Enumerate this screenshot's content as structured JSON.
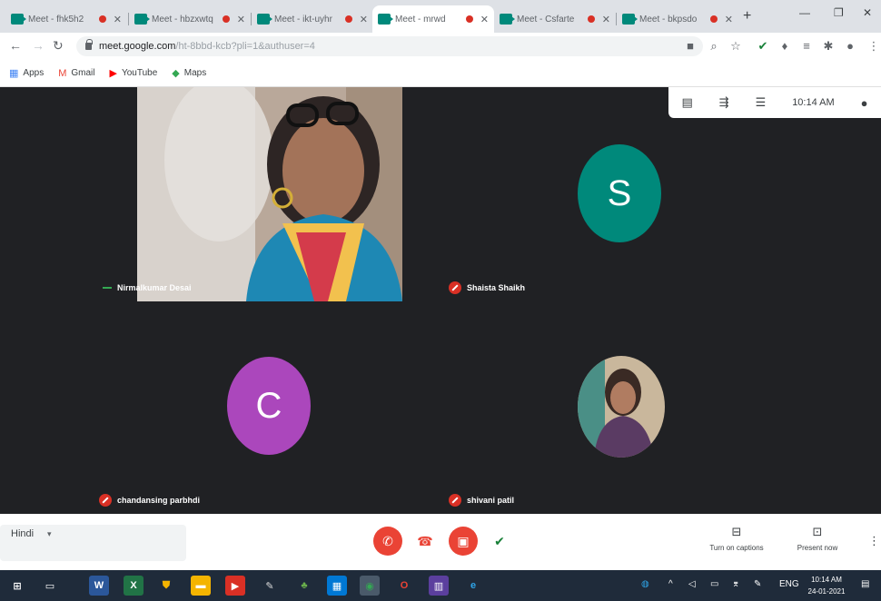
{
  "browser": {
    "tabs": [
      {
        "label": "Meet - fhk5h2",
        "active": false
      },
      {
        "label": "Meet - hbzxwtq",
        "active": false
      },
      {
        "label": "Meet - ikt-uyhr",
        "active": false
      },
      {
        "label": "Meet - mrwd",
        "active": true
      },
      {
        "label": "Meet - Csfarte",
        "active": false
      },
      {
        "label": "Meet - bkpsdo",
        "active": false
      }
    ],
    "new_tab_glyph": "+",
    "window_controls": [
      "—",
      "❐",
      "✕"
    ],
    "url_host": "meet.google.com",
    "url_rest": "/ht-8bbd-kcb?pli=1&authuser=4",
    "bookmarks": [
      {
        "label": "Apps",
        "icon": "apps-grid-icon"
      },
      {
        "label": "Gmail",
        "icon": "gmail-icon"
      },
      {
        "label": "YouTube",
        "icon": "youtube-icon"
      },
      {
        "label": "Maps",
        "icon": "maps-icon"
      }
    ]
  },
  "meet": {
    "top_toolbar_time": "10:14 AM",
    "participants": [
      {
        "name": "Nirmalkumar Desai",
        "status": "speaking"
      },
      {
        "name": "Shaista Shaikh",
        "status": "muted",
        "initial": "S",
        "color": "#00897b"
      },
      {
        "name": "chandansing parbhdi",
        "status": "muted",
        "initial": "C",
        "color": "#ab47bc"
      },
      {
        "name": "shivani patil",
        "status": "muted"
      }
    ],
    "captions_language": "Hindi",
    "controls": {
      "turn_on_captions": "Turn on captions",
      "present_now": "Present now"
    }
  },
  "taskbar": {
    "lang": "ENG",
    "time": "10:14 AM",
    "date": "24-01-2021"
  },
  "colors": {
    "meet_bg": "#202124",
    "tile_bg": "#3c4043",
    "danger": "#ea4335"
  }
}
